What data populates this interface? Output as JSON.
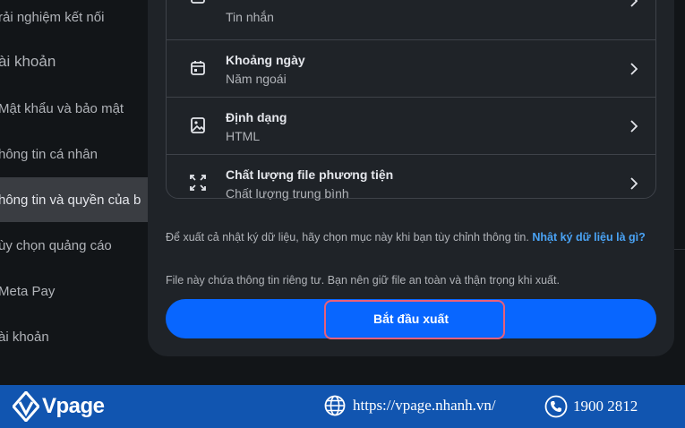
{
  "sidebar": {
    "items": [
      {
        "label": "rải nghiệm kết nối"
      },
      {
        "label": "ài khoản"
      },
      {
        "label": "Mật khẩu và bảo mật"
      },
      {
        "label": "hông tin cá nhân"
      },
      {
        "label": "hông tin và quyền của b"
      },
      {
        "label": "ùy chọn quảng cáo"
      },
      {
        "label": "Meta Pay"
      },
      {
        "label": "ài khoản"
      }
    ]
  },
  "modal": {
    "rows": [
      {
        "title": "",
        "value": "Tin nhắn",
        "icon": "message-icon"
      },
      {
        "title": "Khoảng ngày",
        "value": "Năm ngoái",
        "icon": "calendar-icon"
      },
      {
        "title": "Định dạng",
        "value": "HTML",
        "icon": "image-file-icon"
      },
      {
        "title": "Chất lượng file phương tiện",
        "value": "Chất lượng trung bình",
        "icon": "expand-icon"
      }
    ],
    "note_text": "Để xuất cả nhật ký dữ liệu, hãy chọn mục này khi bạn tùy chỉnh thông tin.",
    "note_link": "Nhật ký dữ liệu là gì?",
    "privacy_text": "File này chứa thông tin riêng tư. Bạn nên giữ file an toàn và thận trọng khi xuất.",
    "export_button": "Bắt đầu xuất"
  },
  "footer": {
    "brand": "Vpage",
    "website": "https://vpage.nhanh.vn/",
    "phone": "1900 2812"
  },
  "colors": {
    "accent": "#0866ff",
    "link": "#4aa3f5",
    "highlight": "#e8607a",
    "footer": "#1155b0"
  }
}
